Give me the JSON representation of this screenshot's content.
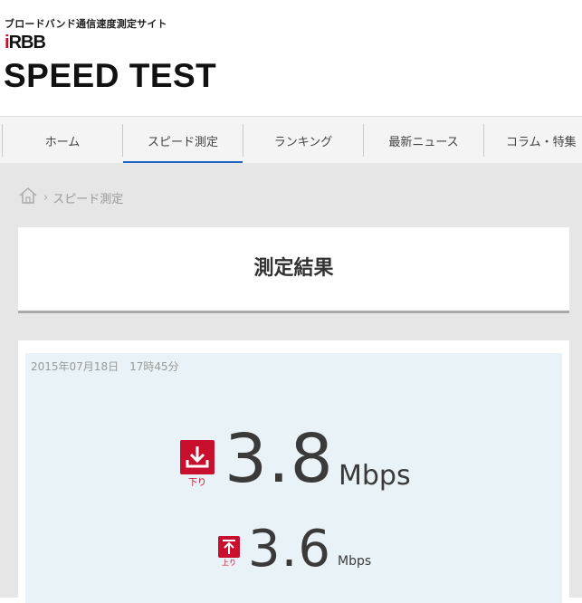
{
  "header": {
    "tagline": "ブロードバンド通信速度測定サイト",
    "logo_small_i": "i",
    "logo_small_rest": "RBB",
    "logo_big": "SPEED TEST"
  },
  "nav": {
    "items": [
      {
        "label": "ホーム"
      },
      {
        "label": "スピード測定",
        "active": true
      },
      {
        "label": "ランキング"
      },
      {
        "label": "最新ニュース"
      },
      {
        "label": "コラム・特集"
      }
    ]
  },
  "breadcrumb": {
    "home_icon": "home-icon",
    "separator": "›",
    "current": "スピード測定"
  },
  "title": "測定結果",
  "result": {
    "date": "2015年07月18日",
    "time": "17時45分",
    "download": {
      "value": "3.8",
      "unit": "Mbps",
      "icon_label": "下り",
      "icon": "download-icon"
    },
    "upload": {
      "value": "3.6",
      "unit": "Mbps",
      "icon_label": "上り",
      "icon": "upload-icon"
    }
  },
  "colors": {
    "accent_red": "#c8102e",
    "nav_active": "#1f66c4",
    "result_bg": "#e9f2f6"
  }
}
